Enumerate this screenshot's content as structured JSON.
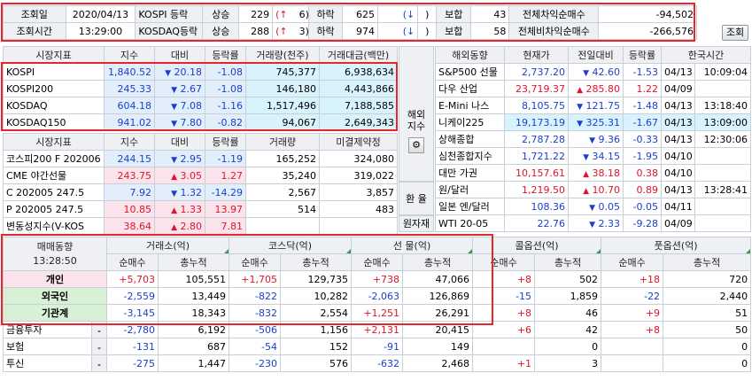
{
  "top": {
    "query_date_label": "조회일",
    "query_date": "2020/04/13",
    "query_time_label": "조회시간",
    "query_time": "13:29:00",
    "kospi_label": "KOSPI 등락",
    "kosdaq_label": "KOSDAQ등락",
    "up_label": "상승",
    "down_label": "하락",
    "flat_label": "보합",
    "kospi_up": "229",
    "kospi_up_limit": "6",
    "kospi_down": "625",
    "kospi_flat": "43",
    "kosdaq_up": "288",
    "kosdaq_up_limit": "3",
    "kosdaq_down": "974",
    "kosdaq_flat": "58",
    "arb_label": "전체차익순매수",
    "arb_value": "-94,502",
    "nonarb_label": "전체비차익순매수",
    "nonarb_value": "-266,576",
    "query_button": "조회"
  },
  "market": {
    "headers": [
      "시장지표",
      "지수",
      "대비",
      "등락률",
      "거래량(천주)",
      "거래대금(백만)"
    ],
    "rows": [
      {
        "name": "KOSPI",
        "index": "1,840.52",
        "change": "20.18",
        "rate": "-1.08",
        "volume": "745,377",
        "amount": "6,938,634"
      },
      {
        "name": "KOSPI200",
        "index": "245.33",
        "change": "2.67",
        "rate": "-1.08",
        "volume": "146,180",
        "amount": "4,443,866"
      },
      {
        "name": "KOSDAQ",
        "index": "604.18",
        "change": "7.08",
        "rate": "-1.16",
        "volume": "1,517,496",
        "amount": "7,188,585"
      },
      {
        "name": "KOSDAQ150",
        "index": "941.02",
        "change": "7.80",
        "rate": "-0.82",
        "volume": "94,067",
        "amount": "2,649,343"
      }
    ]
  },
  "futures": {
    "headers": [
      "시장지표",
      "지수",
      "대비",
      "등락률",
      "거래량",
      "미결제약정"
    ],
    "rows": [
      {
        "name": "코스피200 F 202006",
        "index": "244.15",
        "dir": "down",
        "change": "2.95",
        "rate": "-1.19",
        "volume": "165,252",
        "oi": "324,080"
      },
      {
        "name": "CME 야간선물",
        "index": "243.75",
        "dir": "up",
        "change": "3.05",
        "rate": "1.27",
        "volume": "35,240",
        "oi": "319,022"
      },
      {
        "name": "C 202005 247.5",
        "index": "7.92",
        "dir": "down",
        "change": "1.32",
        "rate": "-14.29",
        "volume": "2,567",
        "oi": "3,857"
      },
      {
        "name": "P 202005 247.5",
        "index": "10.85",
        "dir": "up",
        "change": "1.33",
        "rate": "13.97",
        "volume": "514",
        "oi": "483"
      },
      {
        "name": "변동성지수(V-KOS",
        "index": "38.64",
        "dir": "up",
        "change": "2.80",
        "rate": "7.81",
        "volume": "",
        "oi": ""
      }
    ]
  },
  "side": {
    "overseas_label": "해외\n지수",
    "fx_label": "환 율",
    "commodity_label": "원자재"
  },
  "overseas": {
    "headers": [
      "해외동향",
      "현재가",
      "전일대비",
      "등락률",
      "한국시간"
    ],
    "rows": [
      {
        "name": "S&P500 선물",
        "price": "2,737.20",
        "dir": "down",
        "change": "42.60",
        "rate": "-1.53",
        "date": "04/13",
        "time": "10:09:04"
      },
      {
        "name": "다우 산업",
        "price": "23,719.37",
        "dir": "up",
        "change": "285.80",
        "rate": "1.22",
        "date": "04/09",
        "time": ""
      },
      {
        "name": "E-Mini 나스",
        "price": "8,105.75",
        "dir": "down",
        "change": "121.75",
        "rate": "-1.48",
        "date": "04/13",
        "time": "13:18:40"
      },
      {
        "name": "니케이225",
        "price": "19,173.19",
        "dir": "down",
        "change": "325.31",
        "rate": "-1.67",
        "date": "04/13",
        "time": "13:09:00"
      },
      {
        "name": "상해종합",
        "price": "2,787.28",
        "dir": "down",
        "change": "9.36",
        "rate": "-0.33",
        "date": "04/13",
        "time": "12:30:06"
      },
      {
        "name": "심천종합지수",
        "price": "1,721.22",
        "dir": "down",
        "change": "34.15",
        "rate": "-1.95",
        "date": "04/10",
        "time": ""
      },
      {
        "name": "대만 가권",
        "price": "10,157.61",
        "dir": "up",
        "change": "38.18",
        "rate": "0.38",
        "date": "04/10",
        "time": ""
      },
      {
        "name": "원/달러",
        "price": "1,219.50",
        "dir": "up",
        "change": "10.70",
        "rate": "0.89",
        "date": "04/13",
        "time": "13:28:41"
      },
      {
        "name": "일본 엔/달러",
        "price": "108.36",
        "dir": "down",
        "change": "0.05",
        "rate": "-0.05",
        "date": "04/11",
        "time": ""
      },
      {
        "name": "WTI 20-05",
        "price": "22.76",
        "dir": "down",
        "change": "2.33",
        "rate": "-9.28",
        "date": "04/09",
        "time": ""
      }
    ]
  },
  "trade": {
    "title": "매매동향",
    "time": "13:28:50",
    "groups": [
      "거래소(억)",
      "코스닥(억)",
      "선 물(억)",
      "콜옵션(억)",
      "풋옵션(억)"
    ],
    "sub_net": "순매수",
    "sub_total": "총누적",
    "rows": [
      {
        "name": "개인",
        "style": "pink",
        "dropdown": false,
        "v": [
          "+5,703",
          "105,551",
          "+1,705",
          "129,735",
          "+738",
          "47,066",
          "+8",
          "502",
          "+18",
          "720"
        ]
      },
      {
        "name": "외국인",
        "style": "green",
        "dropdown": false,
        "v": [
          "-2,559",
          "13,449",
          "-822",
          "10,282",
          "-2,063",
          "126,869",
          "-15",
          "1,859",
          "-22",
          "2,440"
        ]
      },
      {
        "name": "기관계",
        "style": "green",
        "dropdown": false,
        "v": [
          "-3,145",
          "18,343",
          "-832",
          "2,554",
          "+1,251",
          "26,291",
          "+8",
          "46",
          "+9",
          "51"
        ]
      },
      {
        "name": "금융투자",
        "style": "plain",
        "dropdown": true,
        "v": [
          "-2,780",
          "6,192",
          "-506",
          "1,156",
          "+2,131",
          "20,415",
          "+6",
          "42",
          "+8",
          "50"
        ]
      },
      {
        "name": "보험",
        "style": "plain",
        "dropdown": true,
        "v": [
          "-131",
          "687",
          "-54",
          "152",
          "-91",
          "149",
          "",
          "0",
          "",
          "0"
        ]
      },
      {
        "name": "투신",
        "style": "plain",
        "dropdown": true,
        "v": [
          "-275",
          "1,447",
          "-230",
          "576",
          "-632",
          "2,468",
          "+1",
          "3",
          "",
          "0"
        ]
      }
    ]
  },
  "colors": {
    "highlight_border": "#e8252a",
    "up": "#e0142a",
    "down": "#1a3fd0"
  }
}
